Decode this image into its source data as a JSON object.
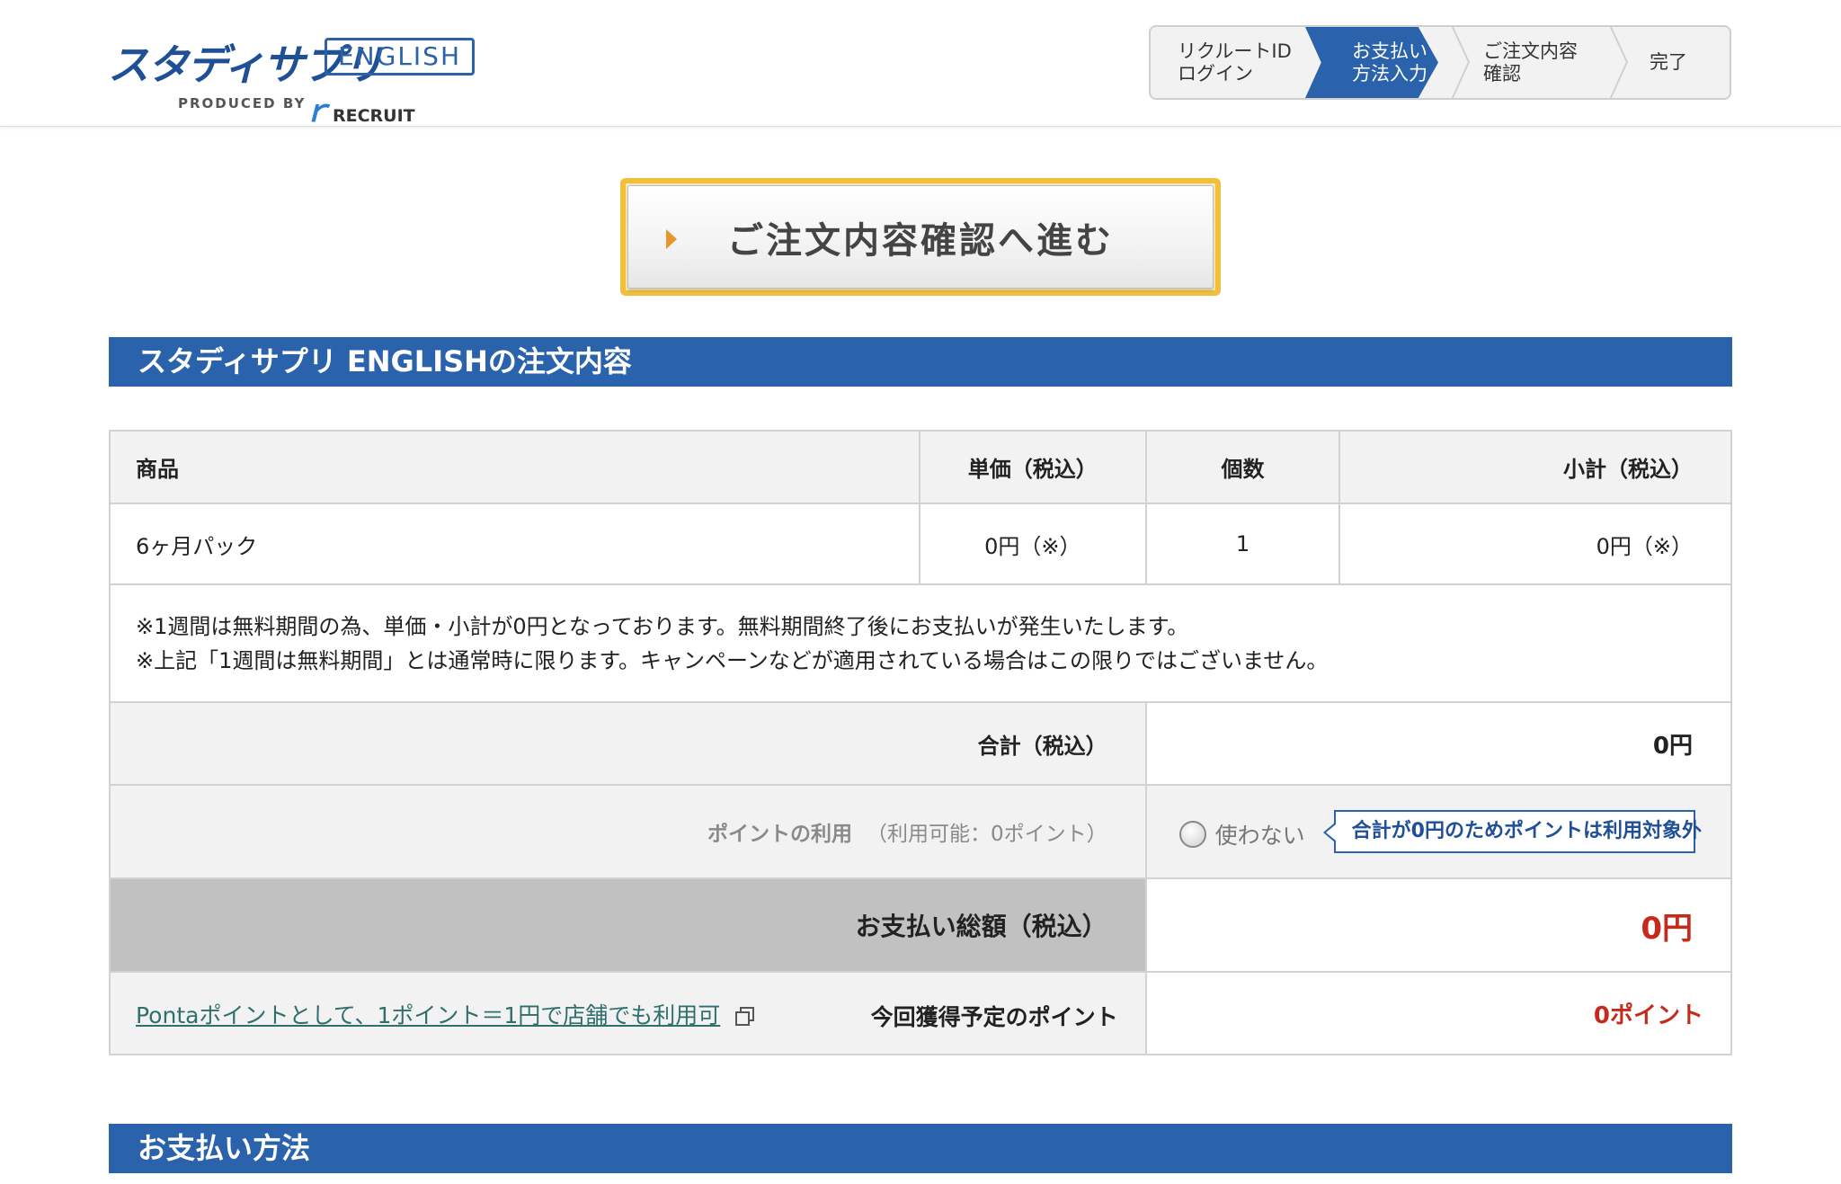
{
  "header": {
    "logo_main": "スタディサプリ",
    "logo_english": "ENGLISH",
    "logo_produced_by": "PRODUCED BY",
    "logo_recruit": "RECRUIT",
    "steps": [
      {
        "line1": "リクルートID",
        "line2": "ログイン",
        "active": false
      },
      {
        "line1": "お支払い",
        "line2": "方法入力",
        "active": true
      },
      {
        "line1": "ご注文内容",
        "line2": "確認",
        "active": false
      },
      {
        "line1": "完了",
        "line2": "",
        "active": false
      }
    ],
    "colors": {
      "brand": "#2a62ab",
      "step_inactive_bg": "#f2f2f2"
    }
  },
  "proceed_button": {
    "label": "ご注文内容確認へ進む",
    "border_color": "#f1bf3c",
    "arrow_color": "#e8962c"
  },
  "order_section": {
    "title": "スタディサプリ ENGLISHの注文内容",
    "columns": {
      "product": "商品",
      "unit_price": "単価（税込）",
      "quantity": "個数",
      "subtotal": "小計（税込）"
    },
    "items": [
      {
        "product": "6ヶ月パック",
        "unit_price": "0円（※）",
        "quantity": "1",
        "subtotal": "0円（※）"
      }
    ],
    "notes": [
      "※1週間は無料期間の為、単価・小計が0円となっております。無料期間終了後にお支払いが発生いたします。",
      "※上記「1週間は無料期間」とは通常時に限ります。キャンペーンなどが適用されている場合はこの限りではございません。"
    ],
    "total": {
      "label": "合計（税込）",
      "value": "0円"
    },
    "points_usage": {
      "label": "ポイントの利用",
      "available": "（利用可能：0ポイント）",
      "option_label": "使わない",
      "tooltip": "合計が0円のためポイントは利用対象外"
    },
    "payment_total": {
      "label": "お支払い総額（税込）",
      "value": "0円",
      "value_color": "#c52a1c"
    },
    "earned_points": {
      "link_text": "Pontaポイントとして、1ポイント＝1円で店舗でも利用可",
      "label": "今回獲得予定のポイント",
      "value": "0ポイント"
    }
  },
  "payment_section": {
    "title": "お支払い方法"
  }
}
